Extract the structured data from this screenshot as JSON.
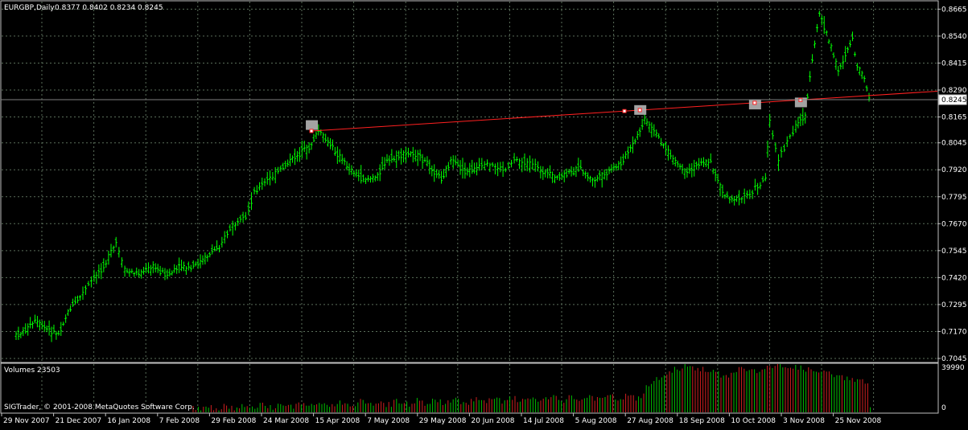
{
  "header": {
    "title": "EURGBP,Daily",
    "ohlc": "0.8377 0.8402 0.8234 0.8245"
  },
  "volume_panel": {
    "label": "Volumes 23503",
    "scale_max_label": "39990",
    "scale_min_label": "0",
    "copyright": "SIGTrader, © 2001-2008 MetaQuotes Software Corp."
  },
  "colors": {
    "background": "#000000",
    "grid": "#5a6e5a",
    "frame": "#c0c0c0",
    "candles": "#00ff00",
    "trendline": "#ff2020",
    "volume_up": "#00c000",
    "volume_down": "#d02020",
    "text": "#ffffff",
    "marker_box": "#c0c0c0"
  },
  "chart_data": {
    "type": "candlestick",
    "symbol": "EURGBP",
    "timeframe": "Daily",
    "y_ticks": [
      "0.8665",
      "0.8540",
      "0.8415",
      "0.8290",
      "0.8165",
      "0.8045",
      "0.7920",
      "0.7795",
      "0.7670",
      "0.7545",
      "0.7420",
      "0.7295",
      "0.7170",
      "0.7045"
    ],
    "ylim": [
      0.703,
      0.87
    ],
    "current_price": "0.8245",
    "x_ticks": [
      "29 Nov 2007",
      "21 Dec 2007",
      "16 Jan 2008",
      "7 Feb 2008",
      "29 Feb 2008",
      "24 Mar 2008",
      "15 Apr 2008",
      "7 May 2008",
      "29 May 2008",
      "20 Jun 2008",
      "14 Jul 2008",
      "5 Aug 2008",
      "27 Aug 2008",
      "18 Sep 2008",
      "10 Oct 2008",
      "3 Nov 2008",
      "25 Nov 2008"
    ],
    "close_path": [
      [
        "29 Nov 2007",
        0.715
      ],
      [
        "3 Dec 2007",
        0.7175
      ],
      [
        "7 Dec 2007",
        0.7215
      ],
      [
        "12 Dec 2007",
        0.718
      ],
      [
        "17 Dec 2007",
        0.716
      ],
      [
        "21 Dec 2007",
        0.726
      ],
      [
        "27 Dec 2007",
        0.733
      ],
      [
        "3 Jan 2008",
        0.742
      ],
      [
        "9 Jan 2008",
        0.749
      ],
      [
        "14 Jan 2008",
        0.758
      ],
      [
        "18 Jan 2008",
        0.745
      ],
      [
        "24 Jan 2008",
        0.744
      ],
      [
        "30 Jan 2008",
        0.747
      ],
      [
        "5 Feb 2008",
        0.743
      ],
      [
        "11 Feb 2008",
        0.747
      ],
      [
        "15 Feb 2008",
        0.746
      ],
      [
        "21 Feb 2008",
        0.751
      ],
      [
        "27 Feb 2008",
        0.757
      ],
      [
        "4 Mar 2008",
        0.766
      ],
      [
        "10 Mar 2008",
        0.769
      ],
      [
        "14 Mar 2008",
        0.782
      ],
      [
        "20 Mar 2008",
        0.787
      ],
      [
        "26 Mar 2008",
        0.792
      ],
      [
        "1 Apr 2008",
        0.798
      ],
      [
        "7 Apr 2008",
        0.802
      ],
      [
        "11 Apr 2008",
        0.81
      ],
      [
        "17 Apr 2008",
        0.802
      ],
      [
        "23 Apr 2008",
        0.794
      ],
      [
        "29 Apr 2008",
        0.788
      ],
      [
        "5 May 2008",
        0.788
      ],
      [
        "9 May 2008",
        0.795
      ],
      [
        "15 May 2008",
        0.798
      ],
      [
        "21 May 2008",
        0.8
      ],
      [
        "27 May 2008",
        0.795
      ],
      [
        "2 Jun 2008",
        0.788
      ],
      [
        "6 Jun 2008",
        0.796
      ],
      [
        "12 Jun 2008",
        0.791
      ],
      [
        "18 Jun 2008",
        0.793
      ],
      [
        "24 Jun 2008",
        0.794
      ],
      [
        "30 Jun 2008",
        0.792
      ],
      [
        "4 Jul 2008",
        0.797
      ],
      [
        "10 Jul 2008",
        0.795
      ],
      [
        "16 Jul 2008",
        0.792
      ],
      [
        "22 Jul 2008",
        0.788
      ],
      [
        "28 Jul 2008",
        0.79
      ],
      [
        "1 Aug 2008",
        0.793
      ],
      [
        "7 Aug 2008",
        0.787
      ],
      [
        "13 Aug 2008",
        0.79
      ],
      [
        "19 Aug 2008",
        0.795
      ],
      [
        "25 Aug 2008",
        0.805
      ],
      [
        "29 Aug 2008",
        0.815
      ],
      [
        "4 Sep 2008",
        0.807
      ],
      [
        "10 Sep 2008",
        0.797
      ],
      [
        "16 Sep 2008",
        0.79
      ],
      [
        "22 Sep 2008",
        0.796
      ],
      [
        "26 Sep 2008",
        0.795
      ],
      [
        "2 Oct 2008",
        0.78
      ],
      [
        "8 Oct 2008",
        0.778
      ],
      [
        "14 Oct 2008",
        0.782
      ],
      [
        "20 Oct 2008",
        0.788
      ],
      [
        "22 Oct 2008",
        0.815
      ],
      [
        "26 Oct 2008",
        0.796
      ],
      [
        "30 Oct 2008",
        0.805
      ],
      [
        "3 Nov 2008",
        0.812
      ],
      [
        "7 Nov 2008",
        0.818
      ],
      [
        "11 Nov 2008",
        0.85
      ],
      [
        "13 Nov 2008",
        0.865
      ],
      [
        "17 Nov 2008",
        0.852
      ],
      [
        "21 Nov 2008",
        0.838
      ],
      [
        "25 Nov 2008",
        0.848
      ],
      [
        "27 Nov 2008",
        0.853
      ],
      [
        "29 Nov 2008",
        0.839
      ],
      [
        "2 Dec 2008",
        0.835
      ],
      [
        "4 Dec 2008",
        0.8245
      ]
    ],
    "trendline": {
      "from": [
        "8 Apr 2008",
        0.81
      ],
      "to": [
        "5 Dec 2008",
        0.8265
      ],
      "extends_right": true
    },
    "markers": [
      {
        "date": "8 Apr 2008",
        "price": 0.812
      },
      {
        "date": "27 Aug 2008",
        "price": 0.819
      },
      {
        "date": "15 Oct 2008",
        "price": 0.8215
      },
      {
        "date": "5 Nov 2008",
        "price": 0.8225
      }
    ],
    "volume_series": [
      [
        "29 Aug 2008",
        0.55
      ],
      [
        "5 Sep 2008",
        0.72
      ],
      [
        "10 Sep 2008",
        0.88
      ],
      [
        "15 Sep 2008",
        0.95
      ],
      [
        "22 Sep 2008",
        0.9
      ],
      [
        "29 Sep 2008",
        0.8
      ],
      [
        "2 Oct 2008",
        0.72
      ],
      [
        "8 Oct 2008",
        0.92
      ],
      [
        "14 Oct 2008",
        0.85
      ],
      [
        "20 Oct 2008",
        0.9
      ],
      [
        "26 Oct 2008",
        0.98
      ],
      [
        "1 Nov 2008",
        0.95
      ],
      [
        "5 Nov 2008",
        0.92
      ],
      [
        "11 Nov 2008",
        0.85
      ],
      [
        "17 Nov 2008",
        0.8
      ],
      [
        "23 Nov 2008",
        0.72
      ],
      [
        "29 Nov 2008",
        0.68
      ],
      [
        "4 Dec 2008",
        0.6
      ]
    ]
  }
}
